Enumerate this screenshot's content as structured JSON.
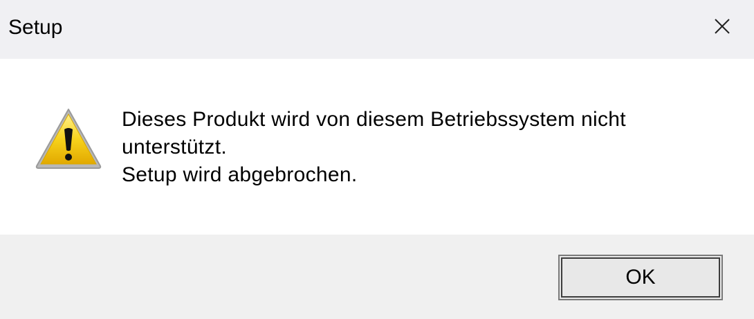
{
  "window": {
    "title": "Setup",
    "close_icon": "close-icon"
  },
  "message": {
    "icon": "warning-icon",
    "line1": "Dieses Produkt wird von diesem Betriebssystem nicht",
    "line2": "unterstützt.",
    "line3": "Setup wird abgebrochen."
  },
  "buttons": {
    "ok_label": "OK"
  },
  "colors": {
    "warning_fill": "#f2c200",
    "warning_border": "#8a8a8a",
    "content_bg": "#ffffff",
    "chrome_bg": "#f0f0f0"
  }
}
